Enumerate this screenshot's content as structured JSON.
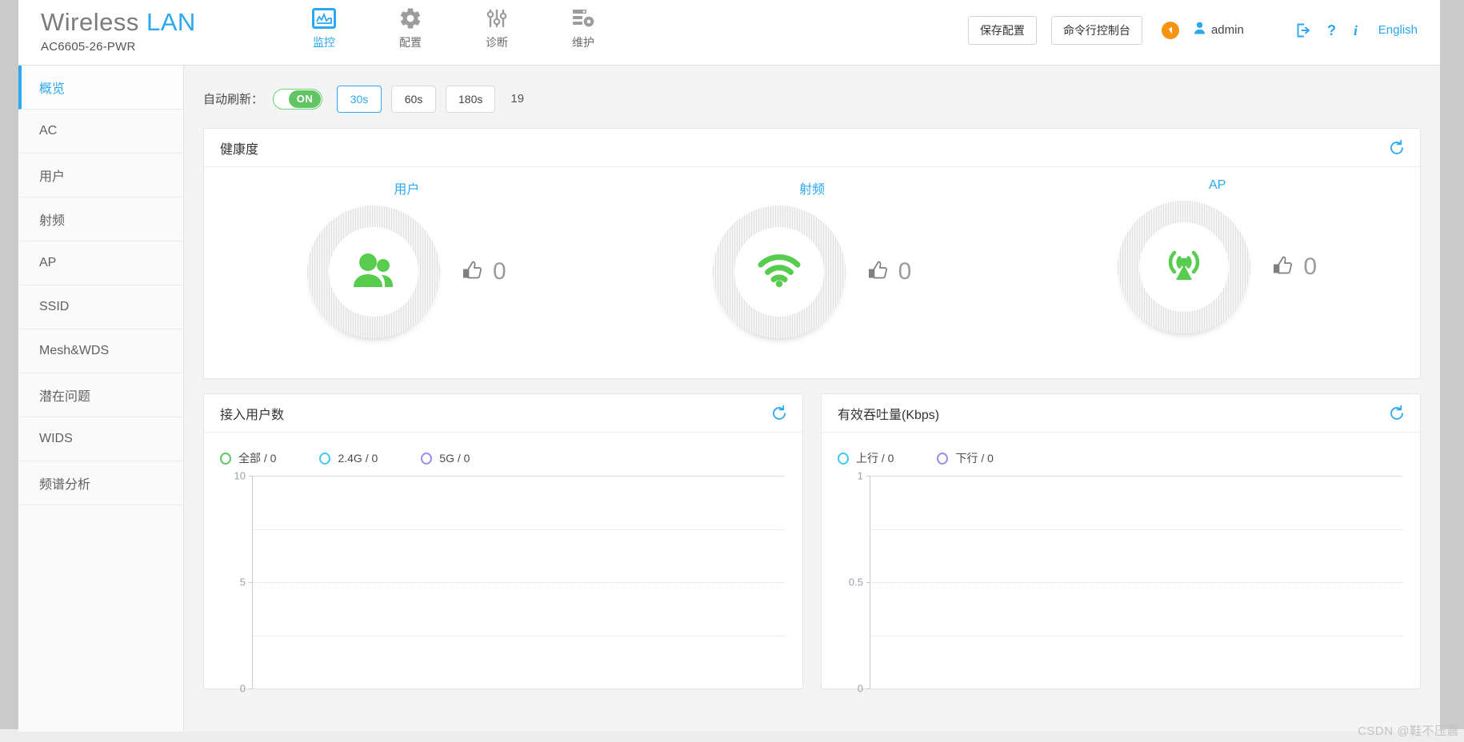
{
  "brand": {
    "title_main": "Wireless",
    "title_accent": "LAN",
    "model": "AC6605-26-PWR"
  },
  "mainnav": [
    {
      "label": "监控",
      "icon": "monitor-icon",
      "active": true
    },
    {
      "label": "配置",
      "icon": "gear-icon",
      "active": false
    },
    {
      "label": "诊断",
      "icon": "sliders-icon",
      "active": false
    },
    {
      "label": "维护",
      "icon": "maintenance-icon",
      "active": false
    }
  ],
  "header": {
    "save_config": "保存配置",
    "cli_console": "命令行控制台",
    "alert_badge": "alert-icon",
    "username": "admin",
    "logout_icon": "logout-icon",
    "help_icon": "question-mark-icon",
    "info_icon": "info-icon",
    "language": "English"
  },
  "sidebar": {
    "items": [
      {
        "label": "概览",
        "active": true
      },
      {
        "label": "AC",
        "active": false
      },
      {
        "label": "用户",
        "active": false
      },
      {
        "label": "射频",
        "active": false
      },
      {
        "label": "AP",
        "active": false
      },
      {
        "label": "SSID",
        "active": false
      },
      {
        "label": "Mesh&WDS",
        "active": false
      },
      {
        "label": "潜在问题",
        "active": false
      },
      {
        "label": "WIDS",
        "active": false
      },
      {
        "label": "频谱分析",
        "active": false
      }
    ]
  },
  "refresh": {
    "label": "自动刷新：",
    "toggle_state": "ON",
    "intervals": [
      {
        "label": "30s",
        "selected": true
      },
      {
        "label": "60s",
        "selected": false
      },
      {
        "label": "180s",
        "selected": false
      }
    ],
    "countdown": "19"
  },
  "health": {
    "title": "健康度",
    "refresh_icon": "refresh-icon",
    "gauges": [
      {
        "label": "用户",
        "icon": "users-icon",
        "score": "0",
        "thumb": "thumbs-up-icon"
      },
      {
        "label": "射频",
        "icon": "wifi-icon",
        "score": "0",
        "thumb": "thumbs-up-icon"
      },
      {
        "label": "AP",
        "icon": "access-point-icon",
        "score": "0",
        "thumb": "thumbs-up-icon"
      }
    ]
  },
  "colors": {
    "accent": "#2ba8f0",
    "green": "#62c462",
    "cyan": "#3fc9ef",
    "purple": "#9a8ce8",
    "orange": "#f59412"
  },
  "chart_data": [
    {
      "type": "line",
      "title": "接入用户数",
      "refresh_icon": "refresh-icon",
      "xlabel": "",
      "ylabel": "",
      "ylim": [
        0,
        10
      ],
      "yticks": [
        0,
        2.5,
        5,
        7.5,
        10
      ],
      "ytick_labels": [
        "0",
        "",
        "5",
        "",
        "10"
      ],
      "grid": true,
      "legend_position": "top-left",
      "series": [
        {
          "name": "全部",
          "value_label": "全部 / 0",
          "current": 0,
          "color": "#62c462",
          "values": []
        },
        {
          "name": "2.4G",
          "value_label": "2.4G / 0",
          "current": 0,
          "color": "#3fc9ef",
          "values": []
        },
        {
          "name": "5G",
          "value_label": "5G / 0",
          "current": 0,
          "color": "#9a8ce8",
          "values": []
        }
      ]
    },
    {
      "type": "line",
      "title": "有效吞吐量(Kbps)",
      "refresh_icon": "refresh-icon",
      "xlabel": "",
      "ylabel": "",
      "ylim": [
        0,
        1
      ],
      "yticks": [
        0,
        0.25,
        0.5,
        0.75,
        1
      ],
      "ytick_labels": [
        "0",
        "",
        "0.5",
        "",
        "1"
      ],
      "grid": true,
      "legend_position": "top-left",
      "series": [
        {
          "name": "上行",
          "value_label": "上行 / 0",
          "current": 0,
          "color": "#3fc9ef",
          "values": []
        },
        {
          "name": "下行",
          "value_label": "下行 / 0",
          "current": 0,
          "color": "#9a8ce8",
          "values": []
        }
      ]
    }
  ],
  "watermark": "CSDN @鞋不压震"
}
